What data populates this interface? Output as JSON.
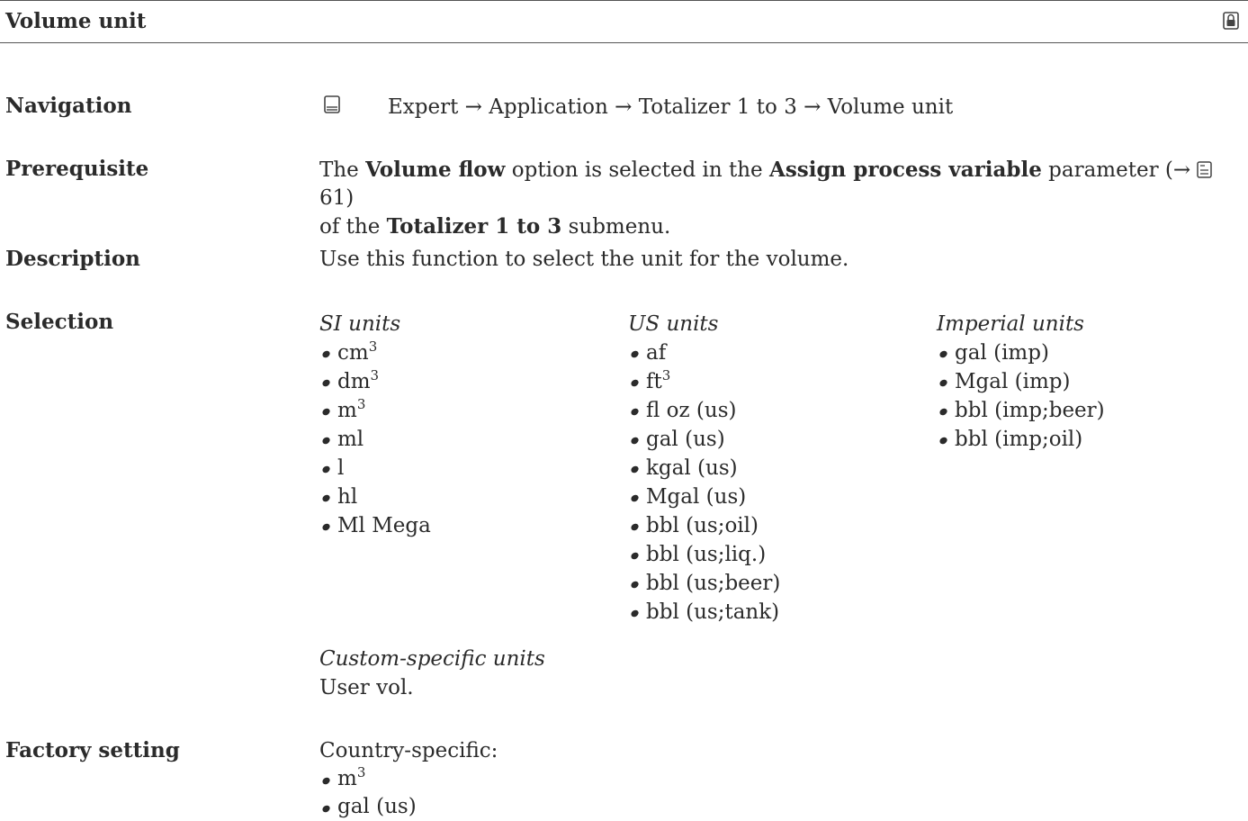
{
  "header": {
    "title": "Volume unit",
    "lock_icon": "lock-icon"
  },
  "navigation": {
    "label": "Navigation",
    "icon": "menu-icon",
    "path": "Expert → Application → Totalizer 1 to 3 → Volume unit"
  },
  "prerequisite": {
    "label": "Prerequisite",
    "t1": "The ",
    "b1": "Volume flow",
    "t2": " option is selected in the ",
    "b2": "Assign process variable",
    "t3": " parameter (→ ",
    "page_ref": "61",
    "t4": ")",
    "t5": "of the ",
    "b3": "Totalizer 1 to 3",
    "t6": " submenu.",
    "book_icon": "book-icon"
  },
  "description": {
    "label": "Description",
    "text": "Use this function to select the unit for the volume."
  },
  "selection": {
    "label": "Selection",
    "si": {
      "heading": "SI units",
      "items": [
        {
          "base": "cm",
          "sup": "3"
        },
        {
          "base": "dm",
          "sup": "3"
        },
        {
          "base": "m",
          "sup": "3"
        },
        {
          "base": "ml",
          "sup": ""
        },
        {
          "base": "l",
          "sup": ""
        },
        {
          "base": "hl",
          "sup": ""
        },
        {
          "base": "Ml Mega",
          "sup": ""
        }
      ]
    },
    "us": {
      "heading": "US units",
      "items": [
        {
          "base": "af",
          "sup": ""
        },
        {
          "base": "ft",
          "sup": "3"
        },
        {
          "base": "fl oz (us)",
          "sup": ""
        },
        {
          "base": "gal (us)",
          "sup": ""
        },
        {
          "base": "kgal (us)",
          "sup": ""
        },
        {
          "base": "Mgal (us)",
          "sup": ""
        },
        {
          "base": "bbl (us;oil)",
          "sup": ""
        },
        {
          "base": "bbl (us;liq.)",
          "sup": ""
        },
        {
          "base": "bbl (us;beer)",
          "sup": ""
        },
        {
          "base": "bbl (us;tank)",
          "sup": ""
        }
      ]
    },
    "imperial": {
      "heading": "Imperial units",
      "items": [
        {
          "base": "gal (imp)",
          "sup": ""
        },
        {
          "base": "Mgal (imp)",
          "sup": ""
        },
        {
          "base": "bbl (imp;beer)",
          "sup": ""
        },
        {
          "base": "bbl (imp;oil)",
          "sup": ""
        }
      ]
    },
    "custom": {
      "heading": "Custom-specific units",
      "value": "User vol."
    }
  },
  "factory": {
    "label": "Factory setting",
    "intro": "Country-specific:",
    "items": [
      {
        "base": "m",
        "sup": "3"
      },
      {
        "base": "gal (us)",
        "sup": ""
      }
    ]
  }
}
